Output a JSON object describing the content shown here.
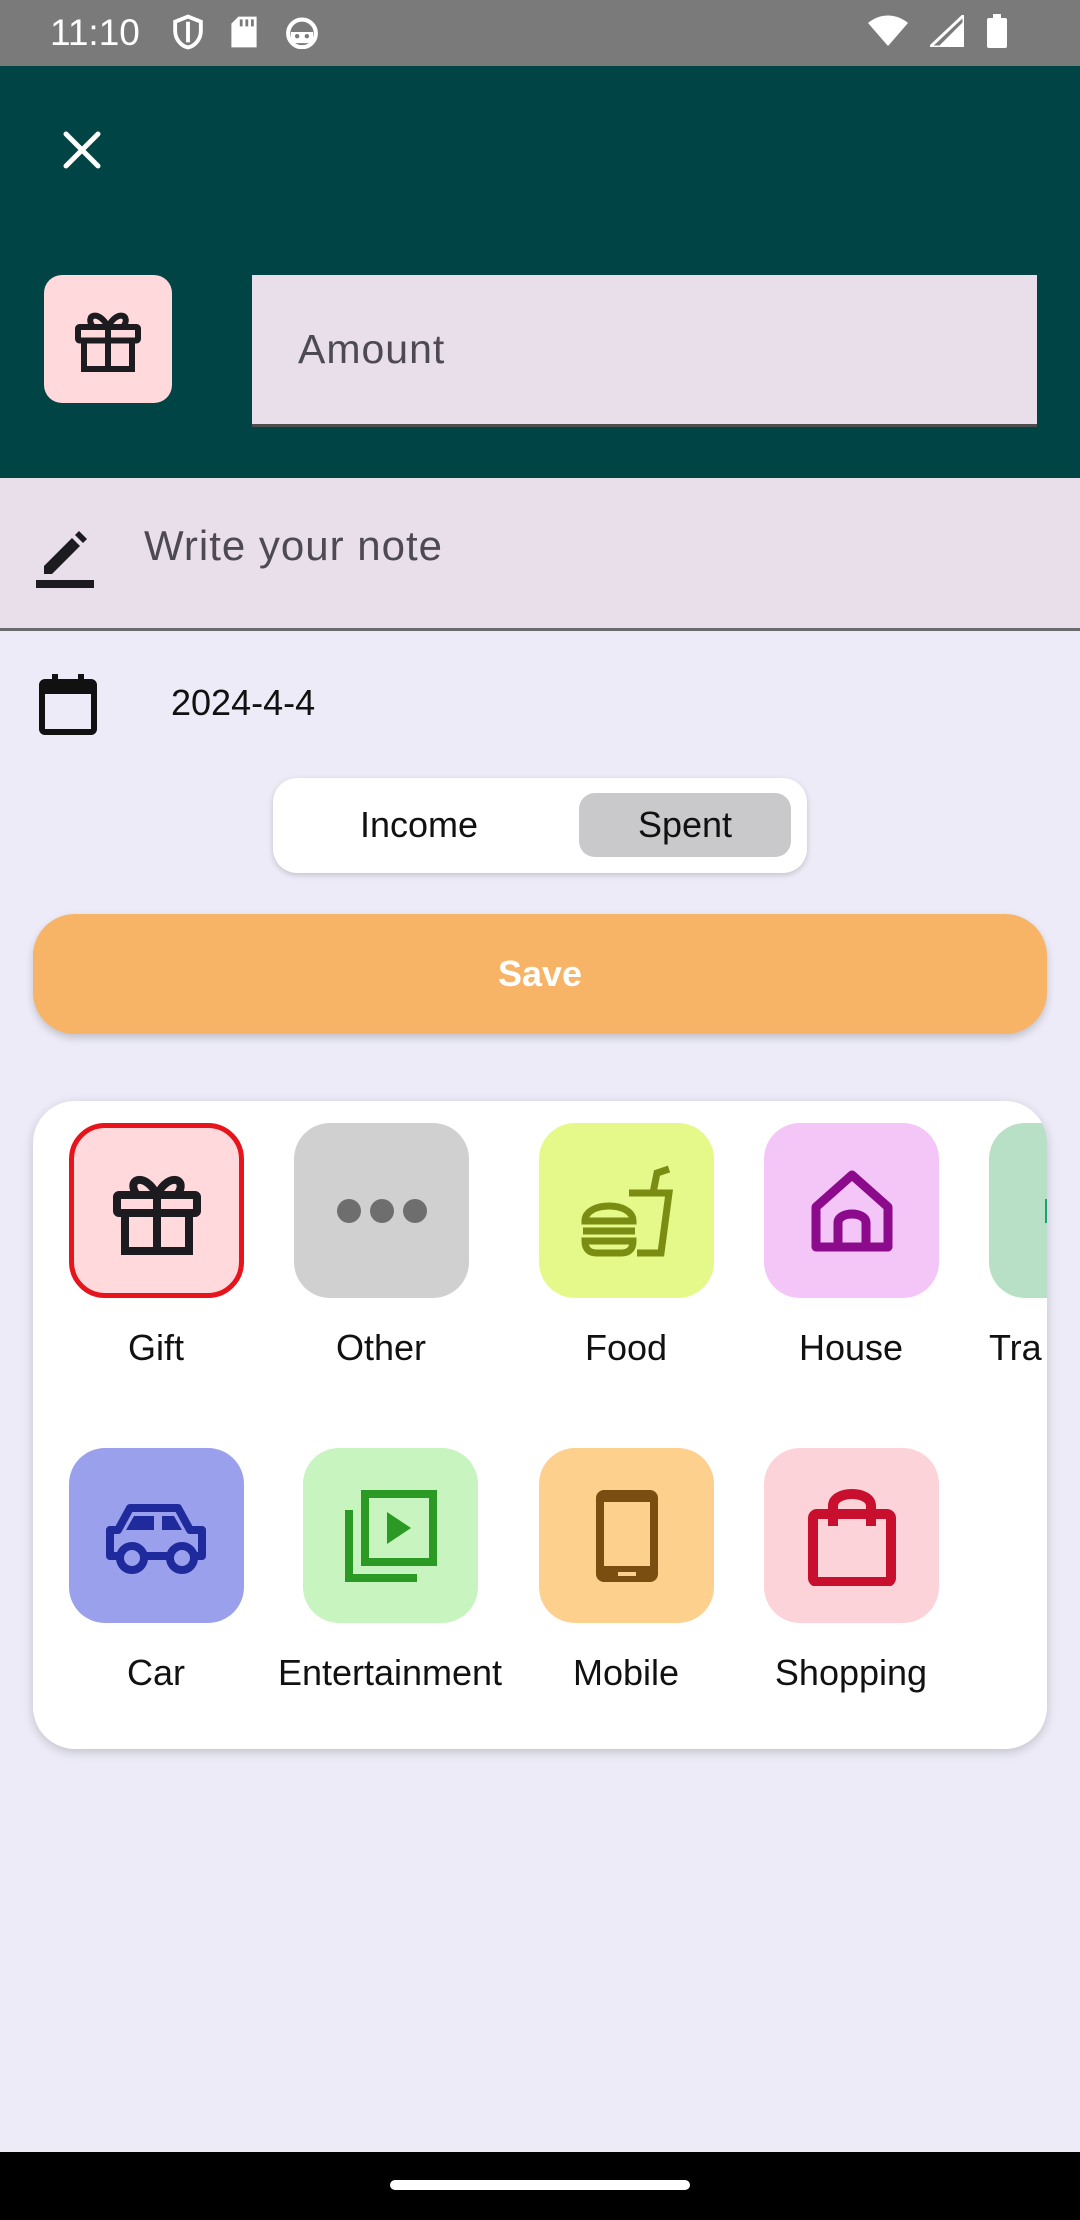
{
  "status_bar": {
    "time": "11:10",
    "left_icons": [
      "shield-icon",
      "sd-card-icon",
      "android-icon"
    ],
    "right_icons": [
      "wifi-icon",
      "signal-icon",
      "battery-icon"
    ]
  },
  "header": {
    "close_icon": "close-icon",
    "selected_category_icon": "gift-icon",
    "amount_placeholder": "Amount",
    "amount_value": ""
  },
  "note": {
    "icon": "pencil-icon",
    "placeholder": "Write your note",
    "value": ""
  },
  "date": {
    "icon": "calendar-icon",
    "value": "2024-4-4"
  },
  "type_toggle": {
    "options": [
      "Income",
      "Spent"
    ],
    "selected": "Spent"
  },
  "save_label": "Save",
  "categories": [
    {
      "label": "Gift",
      "icon": "gift-icon",
      "bg": "#ffd9dc",
      "fg": "#1c1b1f",
      "selected": true
    },
    {
      "label": "Other",
      "icon": "more-horizontal-icon",
      "bg": "#d0d0d0",
      "fg": "#6e6e6e",
      "selected": false
    },
    {
      "label": "Food",
      "icon": "fast-food-icon",
      "bg": "#e4f98a",
      "fg": "#7a8c12",
      "selected": false
    },
    {
      "label": "House",
      "icon": "house-icon",
      "bg": "#f3c6f7",
      "fg": "#8c0a8c",
      "selected": false
    },
    {
      "label": "Tra",
      "icon": "transport-icon",
      "bg": "#b8e0c6",
      "fg": "#1aa36a",
      "selected": false
    },
    {
      "label": "Car",
      "icon": "car-icon",
      "bg": "#9aa0ec",
      "fg": "#1f2a9c",
      "selected": false
    },
    {
      "label": "Entertainment",
      "icon": "video-library-icon",
      "bg": "#c8f5bf",
      "fg": "#2a9a24",
      "selected": false
    },
    {
      "label": "Mobile",
      "icon": "smartphone-icon",
      "bg": "#fdd08e",
      "fg": "#7a4e10",
      "selected": false
    },
    {
      "label": "Shopping",
      "icon": "shopping-bag-icon",
      "bg": "#fdd3da",
      "fg": "#c8102e",
      "selected": false
    }
  ],
  "colors": {
    "header_bg": "#004445",
    "page_bg": "#ecebf7",
    "save_bg": "#f7b366",
    "selected_border": "#e8141c"
  }
}
